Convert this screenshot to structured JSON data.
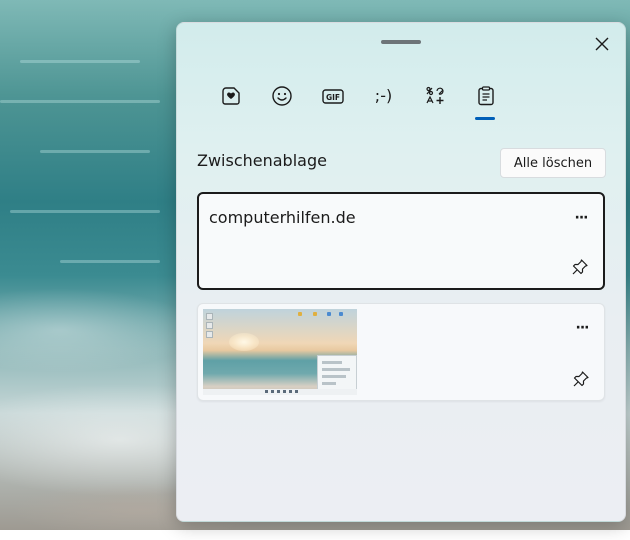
{
  "panel": {
    "section_title": "Zwischenablage",
    "clear_all_label": "Alle löschen",
    "tabs": [
      {
        "name": "tab-favorites",
        "icon": "heart-sticker-icon",
        "label": ""
      },
      {
        "name": "tab-emoji",
        "icon": "smiley-icon",
        "label": ""
      },
      {
        "name": "tab-gif",
        "icon": "gif-icon",
        "label": "GIF"
      },
      {
        "name": "tab-kaomoji",
        "icon": "kaomoji-icon",
        "label": ";-)"
      },
      {
        "name": "tab-symbols",
        "icon": "symbols-icon",
        "label": ""
      },
      {
        "name": "tab-clipboard",
        "icon": "clipboard-icon",
        "label": "",
        "selected": true
      }
    ],
    "items": [
      {
        "type": "text",
        "text": "computerhilfen.de",
        "more_label": "···"
      },
      {
        "type": "image",
        "more_label": "···"
      }
    ]
  },
  "colors": {
    "accent": "#005fb8",
    "text": "#1b1b1b"
  }
}
